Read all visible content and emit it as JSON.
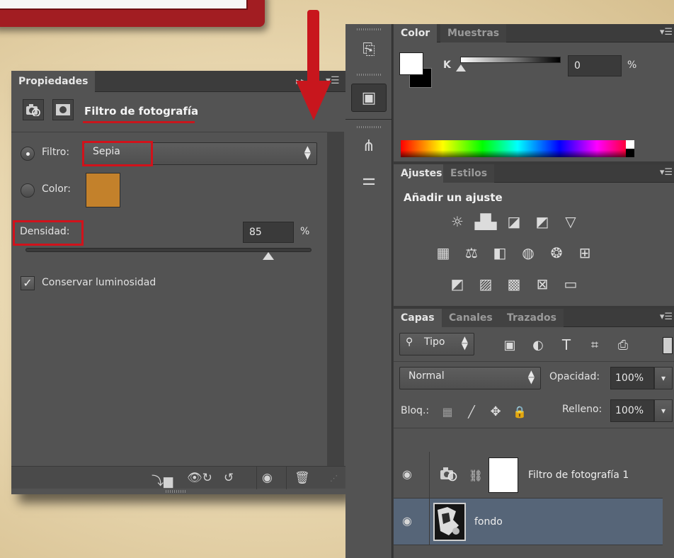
{
  "properties": {
    "tab_label": "Propiedades",
    "title": "Filtro de fotografía",
    "filter_label": "Filtro:",
    "filter_value": "Sepia",
    "color_label": "Color:",
    "color_value": "#c3812b",
    "density_label": "Densidad:",
    "density_value": "85",
    "percent": "%",
    "density_fraction": 0.85,
    "preserve_label": "Conservar luminosidad",
    "preserve_checked": true
  },
  "color_panel": {
    "tab_color": "Color",
    "tab_swatches": "Muestras",
    "k_label": "K",
    "k_value": "0",
    "percent": "%"
  },
  "adjustments_panel": {
    "tab_adjustments": "Ajustes",
    "tab_styles": "Estilos",
    "title": "Añadir un ajuste"
  },
  "layers_panel": {
    "tab_layers": "Capas",
    "tab_channels": "Canales",
    "tab_paths": "Trazados",
    "filter_kind": "Tipo",
    "blend_mode": "Normal",
    "opacity_label": "Opacidad:",
    "opacity_value": "100%",
    "lock_label": "Bloq.:",
    "fill_label": "Relleno:",
    "fill_value": "100%",
    "layers": [
      {
        "name": "Filtro de fotografía 1"
      },
      {
        "name": "fondo"
      }
    ]
  },
  "colors": {
    "accent_red": "#c8161d",
    "panel_bg": "#535353",
    "selected_layer": "#566578"
  }
}
